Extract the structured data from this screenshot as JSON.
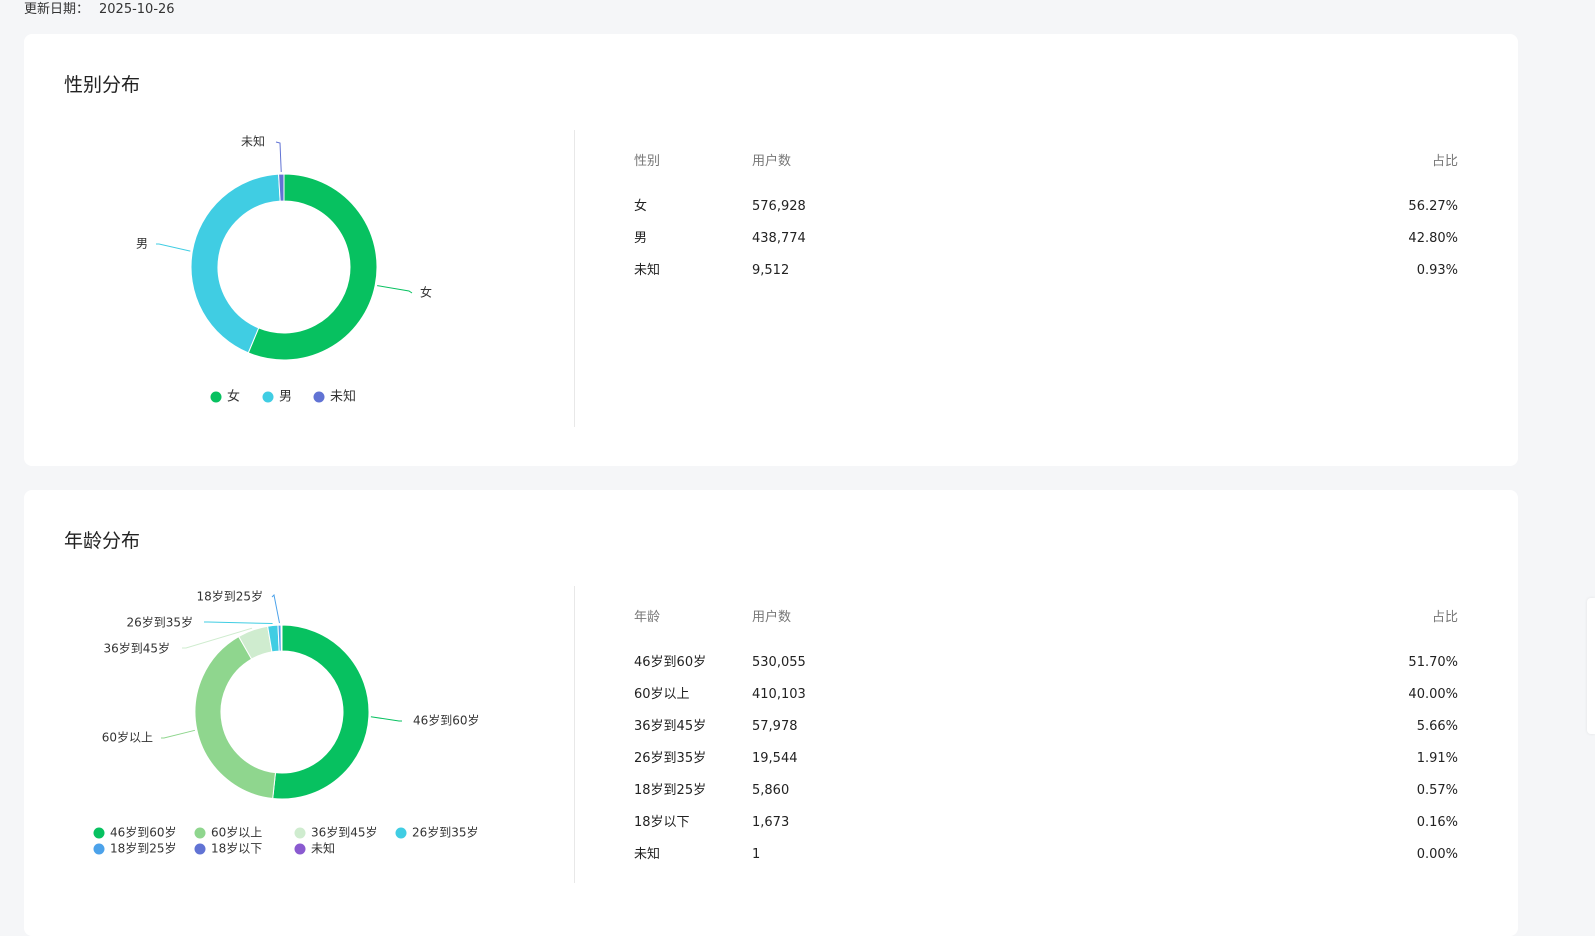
{
  "header": {
    "update_label": "更新日期：",
    "update_date": "2025-10-26"
  },
  "gender": {
    "title": "性别分布",
    "table_headers": {
      "col1": "性别",
      "col2": "用户数",
      "col3": "占比"
    },
    "rows": [
      {
        "label": "女",
        "count": "576,928",
        "percent": "56.27%"
      },
      {
        "label": "男",
        "count": "438,774",
        "percent": "42.80%"
      },
      {
        "label": "未知",
        "count": "9,512",
        "percent": "0.93%"
      }
    ]
  },
  "age": {
    "title": "年龄分布",
    "table_headers": {
      "col1": "年龄",
      "col2": "用户数",
      "col3": "占比"
    },
    "rows": [
      {
        "label": "46岁到60岁",
        "count": "530,055",
        "percent": "51.70%"
      },
      {
        "label": "60岁以上",
        "count": "410,103",
        "percent": "40.00%"
      },
      {
        "label": "36岁到45岁",
        "count": "57,978",
        "percent": "5.66%"
      },
      {
        "label": "26岁到35岁",
        "count": "19,544",
        "percent": "1.91%"
      },
      {
        "label": "18岁到25岁",
        "count": "5,860",
        "percent": "0.57%"
      },
      {
        "label": "18岁以下",
        "count": "1,673",
        "percent": "0.16%"
      },
      {
        "label": "未知",
        "count": "1",
        "percent": "0.00%"
      }
    ]
  },
  "chart_data": [
    {
      "type": "pie",
      "variant": "donut",
      "legend_placement": "bottom",
      "categories": [
        "女",
        "男",
        "未知"
      ],
      "values": [
        576928,
        438774,
        9512
      ],
      "colors": [
        "#07c160",
        "#40cde3",
        "#6173d4"
      ]
    },
    {
      "type": "pie",
      "variant": "donut",
      "legend_placement": "bottom",
      "categories": [
        "46岁到60岁",
        "60岁以上",
        "36岁到45岁",
        "26岁到35岁",
        "18岁到25岁",
        "18岁以下",
        "未知"
      ],
      "values": [
        530055,
        410103,
        57978,
        19544,
        5860,
        1673,
        1
      ],
      "colors": [
        "#07c160",
        "#8fd68e",
        "#cfeccf",
        "#40cde3",
        "#4ca2ea",
        "#6173d4",
        "#8a5ad0"
      ]
    }
  ]
}
